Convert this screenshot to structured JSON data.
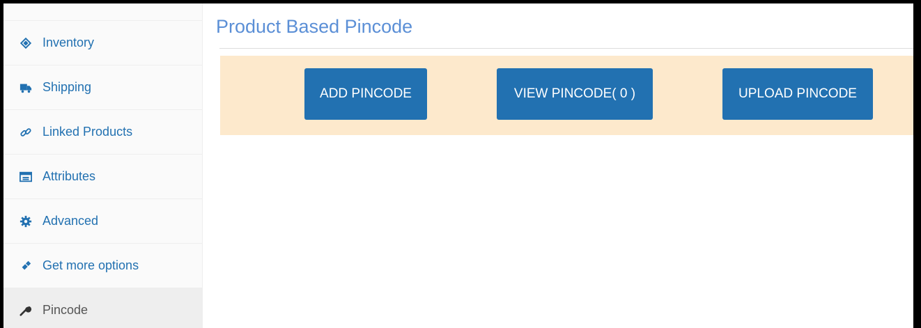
{
  "sidebar": {
    "items": [
      {
        "label": "Inventory",
        "icon": "tag-icon",
        "active": false
      },
      {
        "label": "Shipping",
        "icon": "truck-icon",
        "active": false
      },
      {
        "label": "Linked Products",
        "icon": "link-icon",
        "active": false
      },
      {
        "label": "Attributes",
        "icon": "list-icon",
        "active": false
      },
      {
        "label": "Advanced",
        "icon": "gear-icon",
        "active": false
      },
      {
        "label": "Get more options",
        "icon": "plugin-icon",
        "active": false
      },
      {
        "label": "Pincode",
        "icon": "wrench-icon",
        "active": true
      }
    ]
  },
  "main": {
    "title": "Product Based Pincode",
    "buttons": {
      "add": "ADD PINCODE",
      "view": "VIEW PINCODE( 0 )",
      "upload": "UPLOAD PINCODE"
    }
  },
  "colors": {
    "accent": "#2271b1",
    "title": "#5b8fd6",
    "button_bar_bg": "#fde9cc",
    "sidebar_bg": "#fafafa",
    "active_item_bg": "#eeeeee"
  }
}
